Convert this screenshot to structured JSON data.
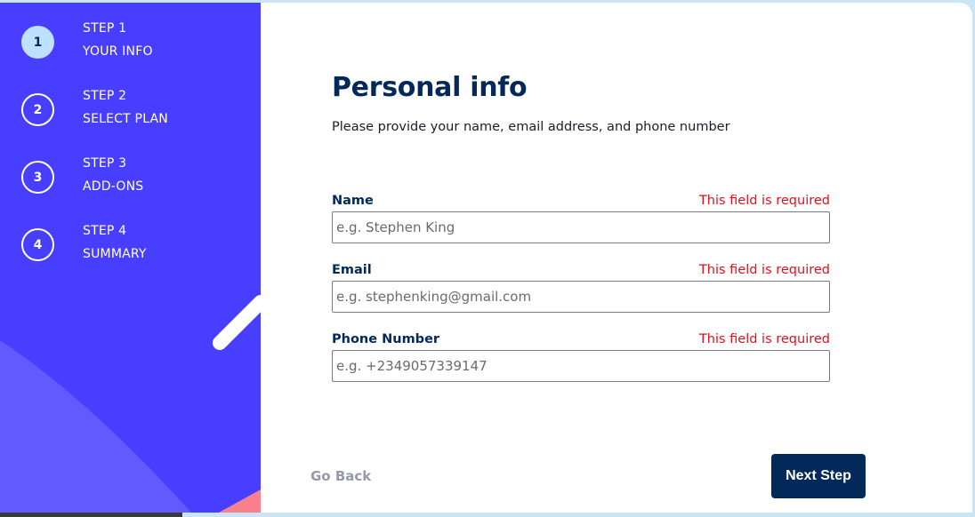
{
  "sidebar": {
    "steps": [
      {
        "number": "1",
        "step_label": "STEP 1",
        "name": "YOUR INFO",
        "active": true
      },
      {
        "number": "2",
        "step_label": "STEP 2",
        "name": "SELECT PLAN",
        "active": false
      },
      {
        "number": "3",
        "step_label": "STEP 3",
        "name": "ADD-ONS",
        "active": false
      },
      {
        "number": "4",
        "step_label": "STEP 4",
        "name": "SUMMARY",
        "active": false
      }
    ],
    "colors": {
      "background": "#483eff",
      "active_circle": "#bee2fd",
      "shape_light": "#6259ff",
      "shape_pink": "#f9818e"
    }
  },
  "main": {
    "title": "Personal info",
    "subtitle": "Please provide your name, email address, and phone number",
    "fields": [
      {
        "label": "Name",
        "error": "This field is required",
        "placeholder": "e.g. Stephen King",
        "value": ""
      },
      {
        "label": "Email",
        "error": "This field is required",
        "placeholder": "e.g. stephenking@gmail.com",
        "value": ""
      },
      {
        "label": "Phone Number",
        "error": "This field is required",
        "placeholder": "e.g. +2349057339147",
        "value": ""
      }
    ],
    "go_back_label": "Go Back",
    "next_step_label": "Next Step"
  },
  "colors": {
    "primary": "#022959",
    "error": "#e20f1c",
    "muted": "#9699aa"
  }
}
